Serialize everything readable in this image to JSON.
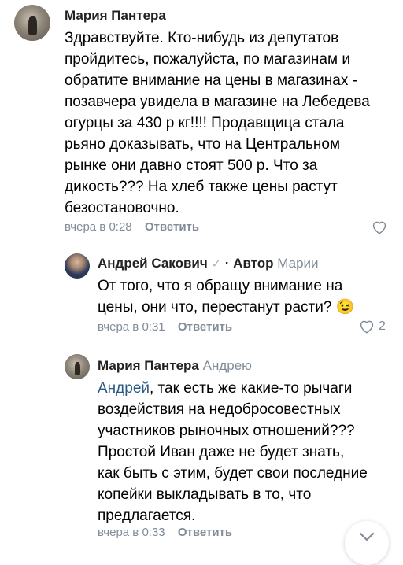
{
  "comments": [
    {
      "author": "Мария Пантера",
      "reply_to": "",
      "lines": [
        "Здравствуйте. Кто-нибудь из депутатов",
        "пройдитесь, пожалуйста, по магазинам и",
        "обратите внимание на цены в магазинах -",
        "позавчера увидела в магазине на Лебедева",
        "огурцы за 430 р кг!!!! Продавщица стала",
        "рьяно доказывать, что на Центральном",
        "рынке они давно стоят 500 р. Что за",
        "дикость??? На хлеб также цены растут",
        "безостановочно."
      ],
      "time": "вчера в 0:28",
      "reply_label": "Ответить",
      "likes": ""
    },
    {
      "author": "Андрей Сакович",
      "check": "✓",
      "badge": "· Автор",
      "reply_to": "Марии",
      "lines": [
        "От того, что я обращу внимание на",
        "цены, они что, перестанут расти? 😉"
      ],
      "time": "вчера в 0:31",
      "reply_label": "Ответить",
      "likes": "2"
    },
    {
      "author": "Мария Пантера",
      "reply_to": "Андрею",
      "mention": "Андрей",
      "first_line_rest": ", так есть же какие-то рычаги",
      "lines": [
        "воздействия на недобросовестных",
        "участников рыночных отношений???",
        "Простой Иван даже не будет знать,",
        "как быть с этим, будет свои последние",
        "копейки выкладывать в то, что",
        "предлагается."
      ],
      "time": "вчера в 0:33",
      "reply_label": "Ответить",
      "likes": ""
    }
  ],
  "icons": {
    "like": "heart-icon",
    "verified": "checkmark-icon",
    "scroll": "chevron-down-icon"
  },
  "colors": {
    "link": "#2a5885",
    "meta": "#818c99"
  }
}
